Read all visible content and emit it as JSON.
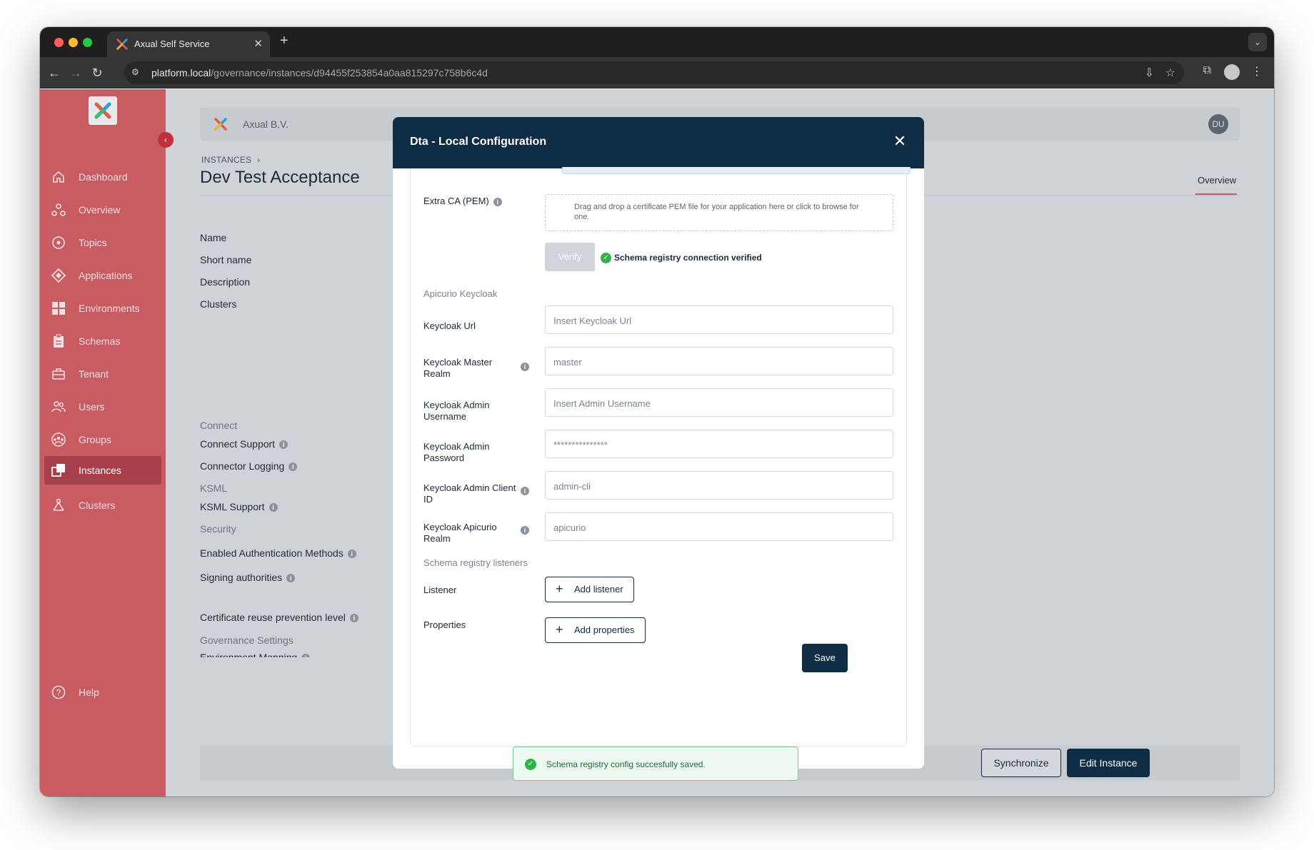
{
  "browser": {
    "tab_title": "Axual Self Service",
    "tab_close": "✕",
    "new_tab": "+",
    "url_host": "platform.local",
    "url_path": "/governance/instances/d94455f253854a0aa815297c758b6c4d"
  },
  "sidebar": {
    "collapse": "‹",
    "items": [
      {
        "label": "Dashboard",
        "icon": "home-icon"
      },
      {
        "label": "Overview",
        "icon": "graph-icon"
      },
      {
        "label": "Topics",
        "icon": "topic-icon"
      },
      {
        "label": "Applications",
        "icon": "diamond-icon"
      },
      {
        "label": "Environments",
        "icon": "grid-icon"
      },
      {
        "label": "Schemas",
        "icon": "clipboard-icon"
      },
      {
        "label": "Tenant",
        "icon": "briefcase-icon"
      },
      {
        "label": "Users",
        "icon": "users-icon"
      },
      {
        "label": "Groups",
        "icon": "groups-icon"
      },
      {
        "label": "Instances",
        "icon": "instances-icon"
      },
      {
        "label": "Clusters",
        "icon": "clusters-icon"
      }
    ],
    "help": "Help",
    "accent": "#c95b63",
    "active_color": "#a8404a"
  },
  "header": {
    "org": "Axual B.V.",
    "avatar": "DU"
  },
  "page": {
    "breadcrumb": "INSTANCES",
    "breadcrumb_sep": "›",
    "title": "Dev Test Acceptance",
    "tab_overview": "Overview",
    "fields": [
      "Name",
      "Short name",
      "Description",
      "Clusters"
    ],
    "section_connect": "Connect",
    "connect_support": "Connect Support",
    "connector_logging": "Connector Logging",
    "section_ksml": "KSML",
    "ksml_support": "KSML Support",
    "section_security": "Security",
    "auth_methods": "Enabled Authentication Methods",
    "signing_authorities": "Signing authorities",
    "cert_reuse": "Certificate reuse prevention level",
    "section_governance": "Governance Settings",
    "env_mapping": "Environment Mapping",
    "btn_sync": "Synchronize",
    "btn_edit": "Edit Instance"
  },
  "modal": {
    "title": "Dta - Local Configuration",
    "close": "✕",
    "extra_ca_label": "Extra CA (PEM)",
    "dropzone_text": "Drag and drop a certificate PEM file for your application here or click to browse for one.",
    "verify": "Verify",
    "verified_msg": "Schema registry connection verified",
    "section_keycloak": "Apicurio Keycloak",
    "keycloak_url_label": "Keycloak Url",
    "keycloak_url_placeholder": "Insert Keycloak Url",
    "master_realm_label": "Keycloak Master Realm",
    "master_realm_value": "master",
    "admin_user_label": "Keycloak Admin Username",
    "admin_user_placeholder": "Insert Admin Username",
    "admin_pass_label": "Keycloak Admin Password",
    "admin_pass_value": "***************",
    "client_id_label": "Keycloak Admin Client ID",
    "client_id_value": "admin-cli",
    "apicurio_realm_label": "Keycloak Apicurio Realm",
    "apicurio_realm_value": "apicurio",
    "section_listeners": "Schema registry listeners",
    "listener_label": "Listener",
    "add_listener": "Add listener",
    "properties_label": "Properties",
    "add_properties": "Add properties",
    "save": "Save",
    "header_color": "#0e2c43"
  },
  "toast": {
    "message": "Schema registry config succesfully saved.",
    "color": "#2fb34a"
  }
}
